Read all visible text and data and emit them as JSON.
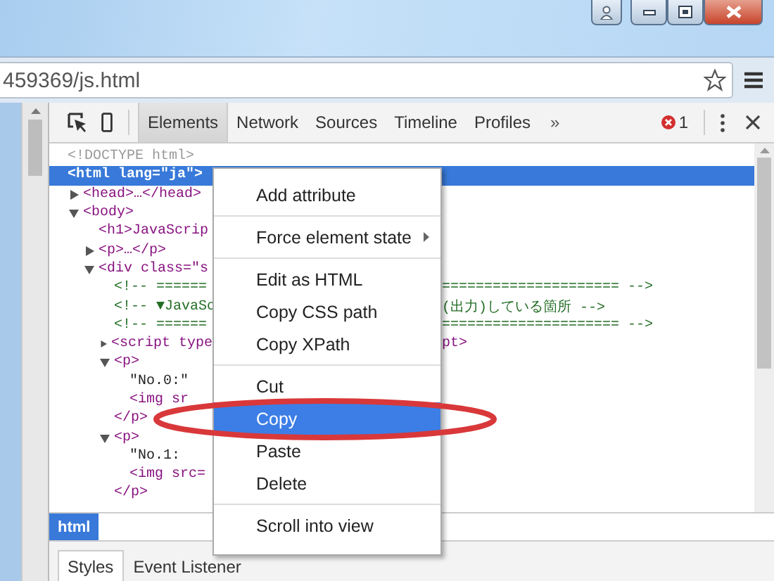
{
  "address_bar": {
    "url": "459369/js.html"
  },
  "devtools": {
    "tabs": [
      {
        "label": "Elements",
        "selected": true
      },
      {
        "label": "Network",
        "selected": false
      },
      {
        "label": "Sources",
        "selected": false
      },
      {
        "label": "Timeline",
        "selected": false
      },
      {
        "label": "Profiles",
        "selected": false
      }
    ],
    "more": "»",
    "error_count": "1",
    "dom_tree": [
      {
        "kind": "doctype",
        "text": "<!DOCTYPE html>",
        "selected": false
      },
      {
        "kind": "tag",
        "text": "<html lang=\"ja\">",
        "selected": true,
        "children": [
          {
            "kind": "tag",
            "text": "<head>…</head>",
            "expanded": false,
            "selected": false
          },
          {
            "kind": "tag",
            "text": "<body>",
            "expanded": true,
            "selected": false,
            "children": [
              {
                "kind": "tag",
                "text": "<h1>JavaScrip",
                "selected": false
              },
              {
                "kind": "tag",
                "text": "<p>…</p>",
                "expanded": false,
                "selected": false
              },
              {
                "kind": "tag",
                "text": "<div class=\"s",
                "expanded": true,
                "selected": false,
                "children": [
                  {
                    "kind": "comment",
                    "text": "<!-- ======",
                    "tail": "===================== -->",
                    "selected": false
                  },
                  {
                    "kind": "comment",
                    "text": "<!-- ▼JavaSc",
                    "tail": "(出力)している箇所 -->",
                    "selected": false
                  },
                  {
                    "kind": "comment",
                    "text": "<!-- ======",
                    "tail": "===================== -->",
                    "selected": false
                  },
                  {
                    "kind": "tag",
                    "text": "<script type",
                    "tail": "pt>",
                    "expanded": false,
                    "selected": false
                  },
                  {
                    "kind": "tag",
                    "text": "<p>",
                    "expanded": true,
                    "selected": false,
                    "children": [
                      {
                        "kind": "text",
                        "text": "\"No.0:\"",
                        "selected": false
                      },
                      {
                        "kind": "tag",
                        "text": "<img sr",
                        "selected": false
                      }
                    ]
                  },
                  {
                    "kind": "tag",
                    "text": "</p>",
                    "selected": false
                  },
                  {
                    "kind": "tag",
                    "text": "<p>",
                    "expanded": true,
                    "selected": false,
                    "children": [
                      {
                        "kind": "text",
                        "text": "\"No.1:",
                        "selected": false
                      },
                      {
                        "kind": "tag",
                        "text": "<img src=",
                        "selected": false
                      }
                    ]
                  },
                  {
                    "kind": "tag",
                    "text": "</p>",
                    "selected": false
                  }
                ]
              }
            ]
          }
        ]
      }
    ],
    "breadcrumb": [
      {
        "label": "html",
        "selected": true
      }
    ],
    "sidebar_tabs": [
      {
        "label": "Styles",
        "selected": true
      },
      {
        "label": "Event Listener",
        "selected": false
      }
    ]
  },
  "context_menu": {
    "groups": [
      [
        {
          "label": "Add attribute",
          "selected": false
        }
      ],
      [
        {
          "label": "Force element state",
          "selected": false,
          "submenu": true
        }
      ],
      [
        {
          "label": "Edit as HTML",
          "selected": false
        },
        {
          "label": "Copy CSS path",
          "selected": false
        },
        {
          "label": "Copy XPath",
          "selected": false
        }
      ],
      [
        {
          "label": "Cut",
          "selected": false
        },
        {
          "label": "Copy",
          "selected": true
        },
        {
          "label": "Paste",
          "selected": false
        },
        {
          "label": "Delete",
          "selected": false
        }
      ],
      [
        {
          "label": "Scroll into view",
          "selected": false
        }
      ]
    ]
  }
}
